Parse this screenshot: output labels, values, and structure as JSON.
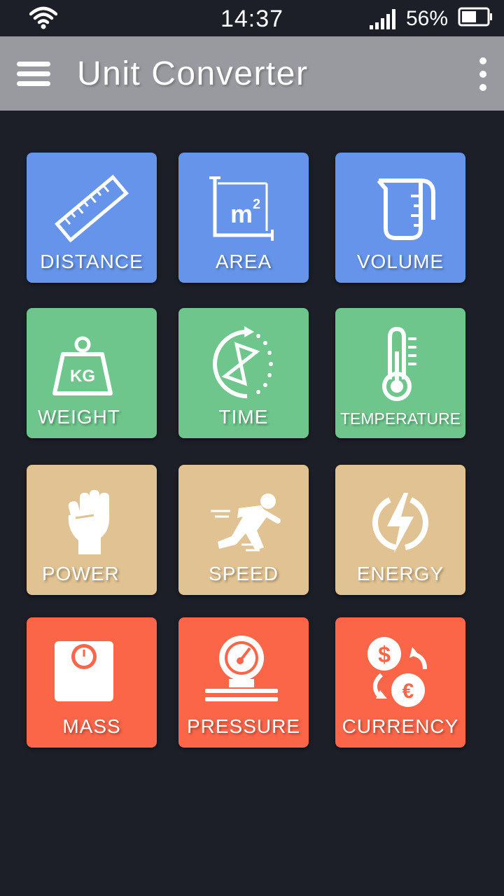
{
  "status_bar": {
    "time": "14:37",
    "battery_percent": "56%",
    "icons": [
      "wifi-icon",
      "signal-icon",
      "battery-icon"
    ]
  },
  "app_bar": {
    "title": "Unit Converter",
    "menu_icon": "hamburger-menu-icon",
    "overflow_icon": "more-vert-icon"
  },
  "colors": {
    "background": "#1c1f27",
    "app_bar": "#999a9f",
    "blue": "#6594ea",
    "green": "#6fc68c",
    "tan": "#e1c292",
    "red": "#fb6548"
  },
  "categories": [
    {
      "label": "DISTANCE",
      "icon": "ruler-icon"
    },
    {
      "label": "AREA",
      "icon": "square-meter-icon"
    },
    {
      "label": "VOLUME",
      "icon": "measuring-cup-icon"
    },
    {
      "label": "WEIGHT",
      "icon": "kg-weight-icon"
    },
    {
      "label": "TIME",
      "icon": "hourglass-timer-icon"
    },
    {
      "label": "TEMPERATURE",
      "icon": "thermometer-icon"
    },
    {
      "label": "POWER",
      "icon": "fist-icon"
    },
    {
      "label": "SPEED",
      "icon": "running-person-icon"
    },
    {
      "label": "ENERGY",
      "icon": "lightning-bolt-icon"
    },
    {
      "label": "MASS",
      "icon": "scale-icon"
    },
    {
      "label": "PRESSURE",
      "icon": "pressure-gauge-icon"
    },
    {
      "label": "CURRENCY",
      "icon": "currency-exchange-icon"
    }
  ]
}
